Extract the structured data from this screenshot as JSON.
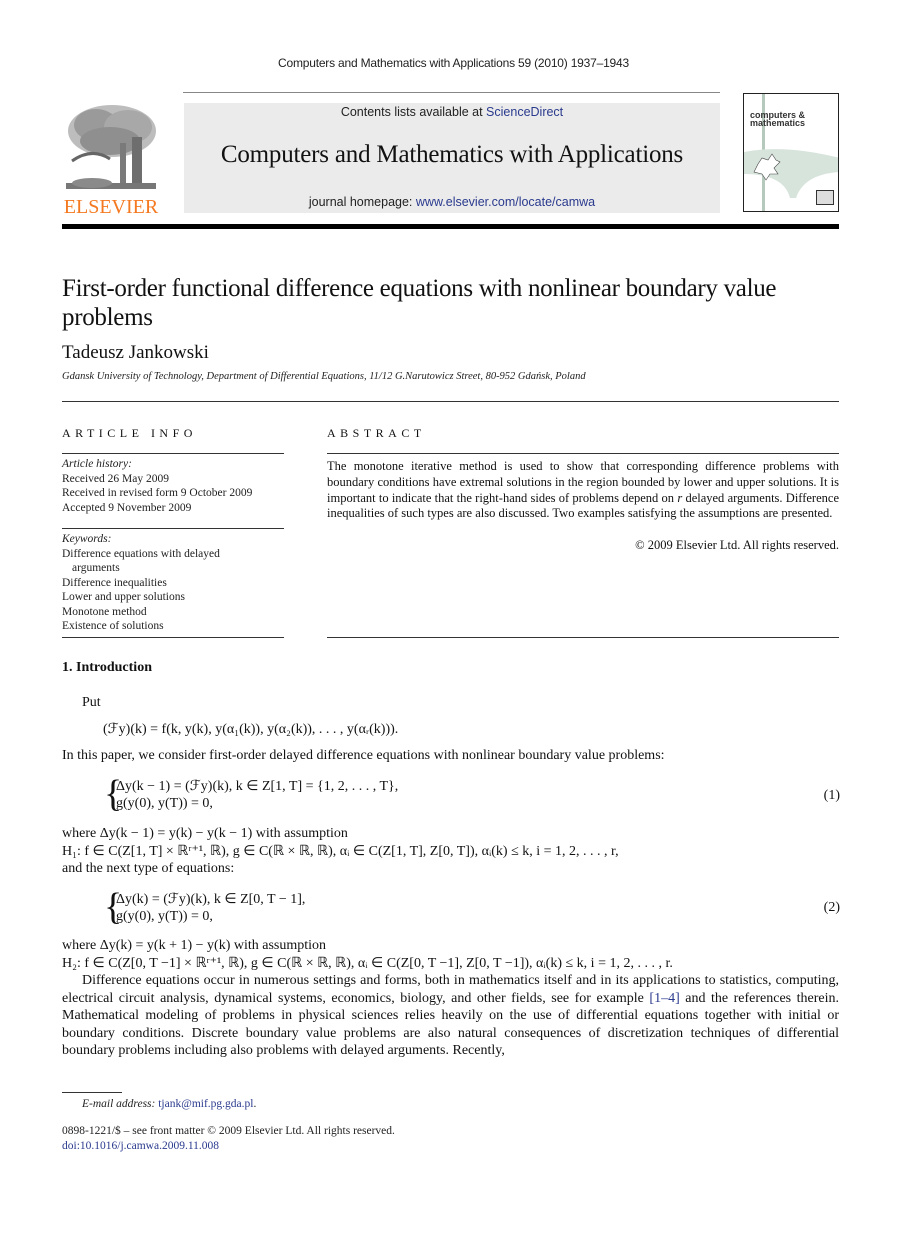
{
  "running_head": "Computers and Mathematics with Applications 59 (2010) 1937–1943",
  "publisher": {
    "logo_text": "ELSEVIER",
    "logo_color": "#f47920"
  },
  "masthead": {
    "contents_prefix": "Contents lists available at ",
    "contents_link": "ScienceDirect",
    "journal_title": "Computers and Mathematics with Applications",
    "homepage_prefix": "journal homepage: ",
    "homepage_link": "www.elsevier.com/locate/camwa",
    "link_color": "#2a3a8e",
    "background": "#ebebeb"
  },
  "cover": {
    "line1": "computers &",
    "line2": "mathematics"
  },
  "article": {
    "title": "First-order functional difference equations with nonlinear boundary value problems",
    "author": "Tadeusz Jankowski",
    "affiliation": "Gdansk University of Technology, Department of Differential Equations, 11/12 G.Narutowicz Street, 80-952 Gdańsk, Poland"
  },
  "article_info": {
    "heading": "ARTICLE INFO",
    "history_label": "Article history:",
    "history": [
      "Received 26 May 2009",
      "Received in revised form 9 October 2009",
      "Accepted 9 November 2009"
    ],
    "keywords_label": "Keywords:",
    "keywords": [
      "Difference equations with delayed",
      "arguments",
      "Difference inequalities",
      "Lower and upper solutions",
      "Monotone method",
      "Existence of solutions"
    ]
  },
  "abstract": {
    "heading": "ABSTRACT",
    "text_before_r": "The monotone iterative method is used to show that corresponding difference problems with boundary conditions have extremal solutions in the region bounded by lower and upper solutions. It is important to indicate that the right-hand sides of problems depend on ",
    "r": "r",
    "text_after_r": " delayed arguments. Difference inequalities of such types are also discussed. Two examples satisfying the assumptions are presented.",
    "copyright": "© 2009 Elsevier Ltd. All rights reserved."
  },
  "introduction": {
    "heading": "1.  Introduction",
    "put": "Put",
    "def_eq": "(ℱy)(k) = f(k, y(k), y(α₁(k)), y(α₂(k)), . . . , y(αᵣ(k))).",
    "consider": "In this paper, we consider first-order delayed difference equations with nonlinear boundary value problems:",
    "eq1_line1": "Δy(k − 1) = (ℱy)(k),     k ∈ Z[1, T] = {1, 2, . . . , T},",
    "eq1_line2": "g(y(0), y(T)) = 0,",
    "eq1_num": "(1)",
    "where1": "where Δy(k − 1) = y(k) − y(k − 1) with assumption",
    "h1": "H₁: f ∈ C(Z[1, T] × ℝʳ⁺¹, ℝ),  g ∈ C(ℝ × ℝ, ℝ),  αᵢ ∈ C(Z[1, T], Z[0, T]),  αᵢ(k) ≤ k,  i = 1, 2, . . . , r,",
    "next_type": "and the next type of equations:",
    "eq2_line1": "Δy(k) = (ℱy)(k),     k ∈ Z[0, T − 1],",
    "eq2_line2": "g(y(0), y(T)) = 0,",
    "eq2_num": "(2)",
    "where2": "where Δy(k) = y(k + 1) − y(k) with assumption",
    "h2": "H₂: f ∈ C(Z[0, T −1] × ℝʳ⁺¹, ℝ),  g ∈ C(ℝ × ℝ, ℝ),  αᵢ ∈ C(Z[0, T −1], Z[0, T −1]),  αᵢ(k) ≤ k,  i = 1, 2, . . . , r.",
    "para_before_ref": "Difference equations occur in numerous settings and forms, both in mathematics itself and in its applications to statistics, computing, electrical circuit analysis, dynamical systems, economics, biology, and other fields, see for example ",
    "ref": "[1–4]",
    "para_after_ref": " and the references therein. Mathematical modeling of problems in physical sciences relies heavily on the use of differential equations together with initial or boundary conditions. Discrete boundary value problems are also natural consequences of discretization techniques of differential boundary problems including also problems with delayed arguments. Recently,"
  },
  "footnote": {
    "email_label": "E-mail address:",
    "email": "tjank@mif.pg.gda.pl",
    "front_matter": "0898-1221/$ – see front matter © 2009 Elsevier Ltd. All rights reserved.",
    "doi": "doi:10.1016/j.camwa.2009.11.008"
  }
}
